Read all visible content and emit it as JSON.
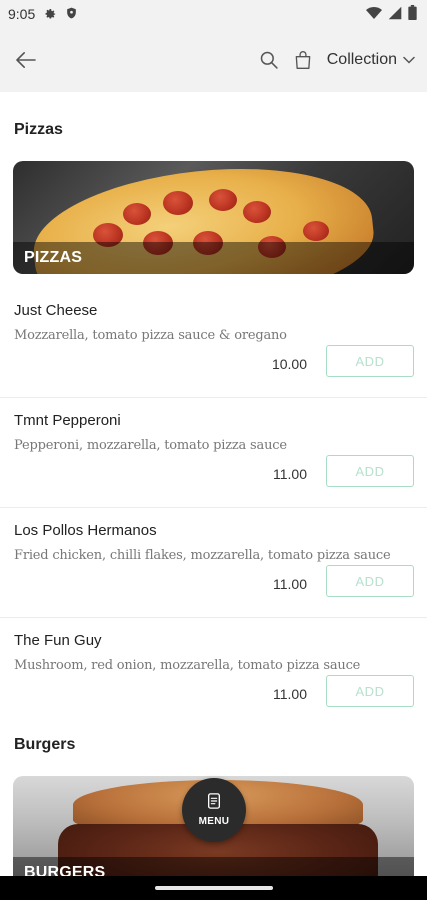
{
  "status_bar": {
    "time": "9:05"
  },
  "app_bar": {
    "collection_label": "Collection"
  },
  "sections": [
    {
      "title": "Pizzas",
      "banner_label": "PIZZAS",
      "items": [
        {
          "name": "Just Cheese",
          "description": "Mozzarella, tomato pizza sauce & oregano",
          "price": "10.00",
          "add_label": "ADD"
        },
        {
          "name": "Tmnt Pepperoni",
          "description": "Pepperoni, mozzarella, tomato pizza sauce",
          "price": "11.00",
          "add_label": "ADD"
        },
        {
          "name": "Los Pollos Hermanos",
          "description": "Fried chicken, chilli flakes, mozzarella, tomato pizza sauce",
          "price": "11.00",
          "add_label": "ADD"
        },
        {
          "name": "The Fun Guy",
          "description": "Mushroom, red onion, mozzarella, tomato pizza sauce",
          "price": "11.00",
          "add_label": "ADD"
        }
      ]
    },
    {
      "title": "Burgers",
      "banner_label": "BURGERS"
    }
  ],
  "menu_fab": {
    "label": "MENU"
  },
  "colors": {
    "add_border": "#a8dcc5",
    "add_text": "#b7e1cf",
    "app_bar_bg": "#f2f2f2"
  }
}
